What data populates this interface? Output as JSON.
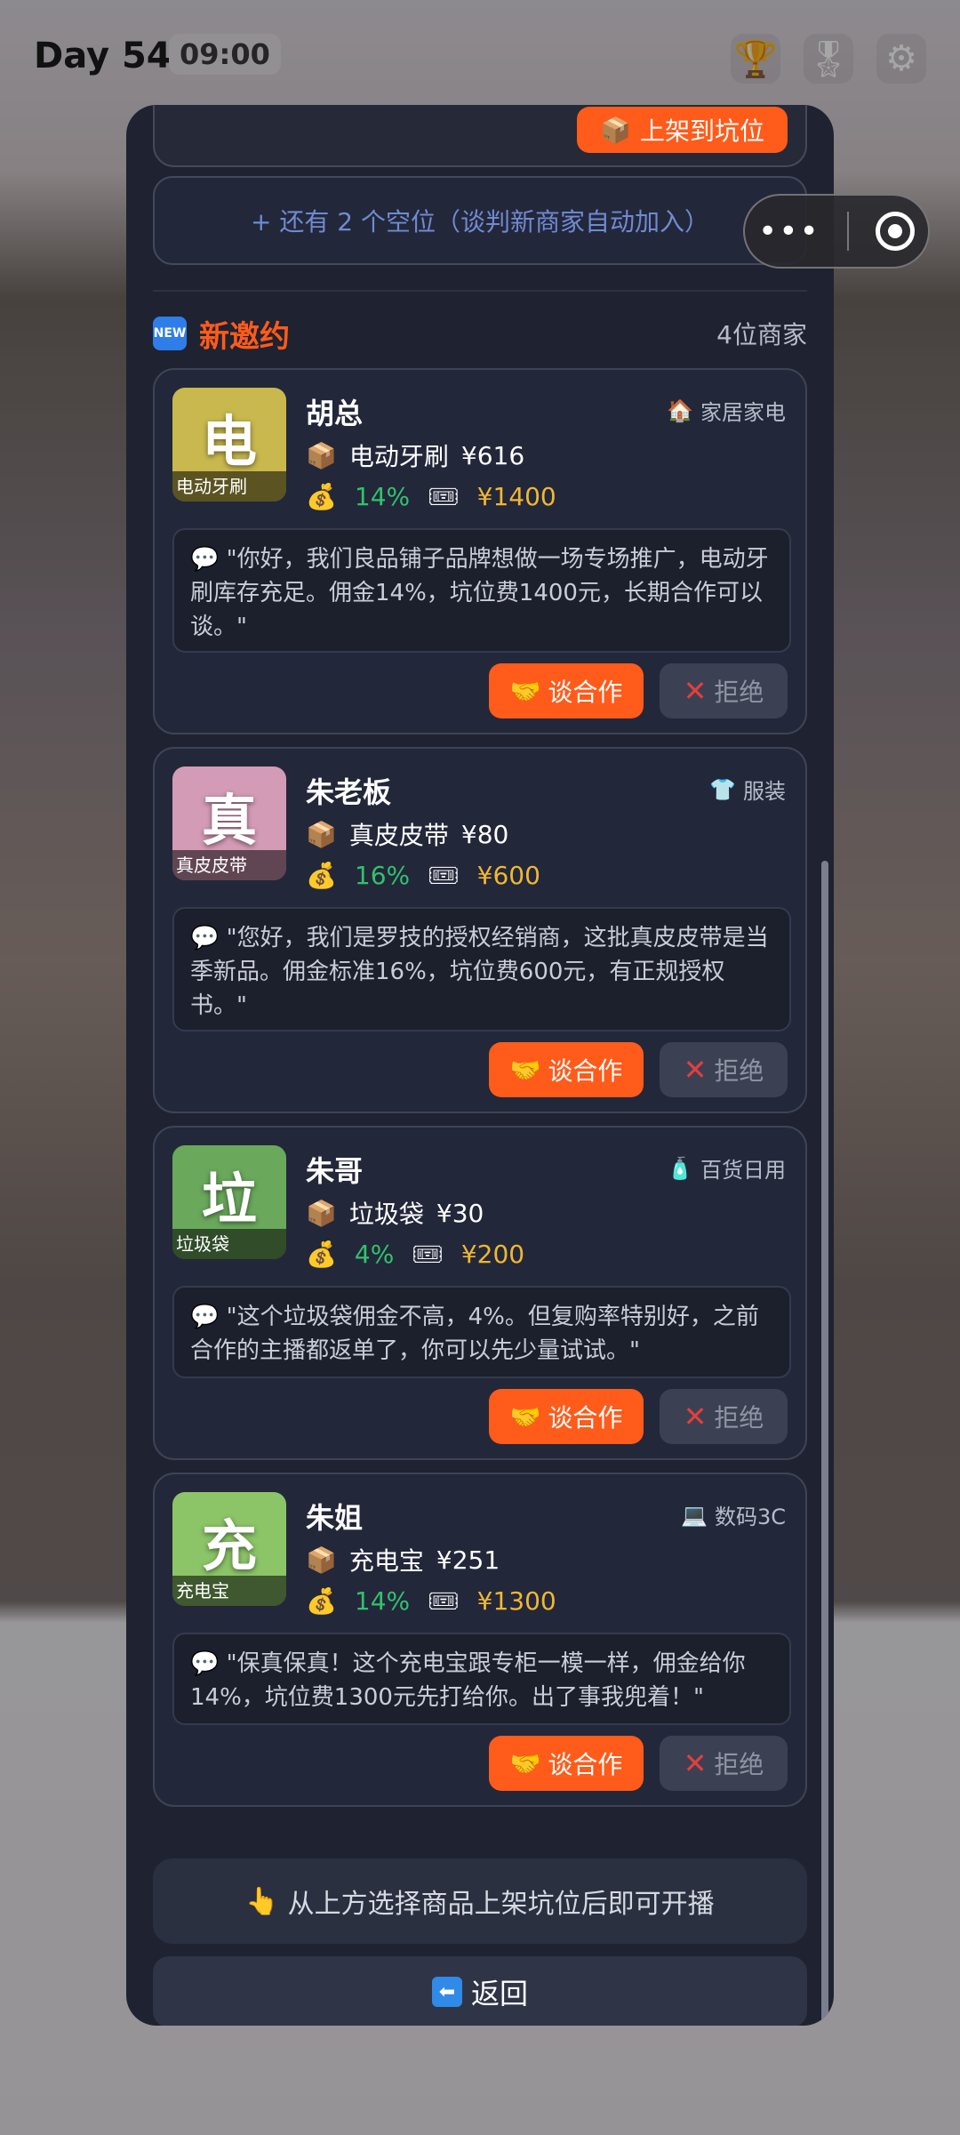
{
  "status": {
    "day": "Day 54",
    "time": "09:00",
    "icons": [
      "trophy-icon",
      "medal-icon",
      "gear-icon"
    ]
  },
  "capsule": {
    "more_glyph": "•••"
  },
  "modal": {
    "shelf_button": "上架到坑位",
    "empty_slots_text": "+ 还有 2 个空位（谈判新商家自动加入）",
    "new_badge": "NEW",
    "section_title": "新邀约",
    "merchant_count": "4位商家",
    "merchants": [
      {
        "name": "胡总",
        "category": "家居家电",
        "category_icon": "🏠",
        "thumb_glyph": "电",
        "thumb_caption": "电动牙刷",
        "thumb_color": "#c9b84d",
        "product": "电动牙刷",
        "price": "¥616",
        "commission": "14%",
        "slot_fee": "¥1400",
        "quote": "\"你好，我们良品铺子品牌想做一场专场推广，电动牙刷库存充足。佣金14%，坑位费1400元，长期合作可以谈。\"",
        "negotiate": "谈合作",
        "reject": "拒绝"
      },
      {
        "name": "朱老板",
        "category": "服装",
        "category_icon": "👕",
        "thumb_glyph": "真",
        "thumb_caption": "真皮皮带",
        "thumb_color": "#d49bb6",
        "product": "真皮皮带",
        "price": "¥80",
        "commission": "16%",
        "slot_fee": "¥600",
        "quote": "\"您好，我们是罗技的授权经销商，这批真皮皮带是当季新品。佣金标准16%，坑位费600元，有正规授权书。\"",
        "negotiate": "谈合作",
        "reject": "拒绝"
      },
      {
        "name": "朱哥",
        "category": "百货日用",
        "category_icon": "🧴",
        "thumb_glyph": "垃",
        "thumb_caption": "垃圾袋",
        "thumb_color": "#6aa85c",
        "product": "垃圾袋",
        "price": "¥30",
        "commission": "4%",
        "slot_fee": "¥200",
        "quote": "\"这个垃圾袋佣金不高，4%。但复购率特别好，之前合作的主播都返单了，你可以先少量试试。\"",
        "negotiate": "谈合作",
        "reject": "拒绝"
      },
      {
        "name": "朱姐",
        "category": "数码3C",
        "category_icon": "💻",
        "thumb_glyph": "充",
        "thumb_caption": "充电宝",
        "thumb_color": "#8cc468",
        "product": "充电宝",
        "price": "¥251",
        "commission": "14%",
        "slot_fee": "¥1300",
        "quote": "\"保真保真！这个充电宝跟专柜一模一样，佣金给你14%，坑位费1300元先打给你。出了事我兜着！\"",
        "negotiate": "谈合作",
        "reject": "拒绝"
      }
    ],
    "hint": "从上方选择商品上架坑位后即可开播",
    "back": "返回"
  }
}
